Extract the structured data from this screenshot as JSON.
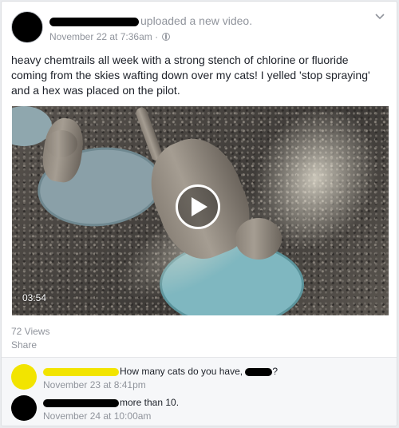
{
  "post": {
    "action_text": "uploaded a new video.",
    "timestamp": "November 22 at 7:36am",
    "meta_separator": "·",
    "text": "heavy chemtrails all week with a strong stench of chlorine or fluoride coming from the skies wafting down over my cats! I yelled 'stop spraying' and a hex was placed on the pilot.",
    "video": {
      "duration": "03:54"
    },
    "views": "72 Views",
    "share_label": "Share"
  },
  "comments": [
    {
      "text_before": "How many cats do you have, ",
      "text_after": "?",
      "time": "November 23 at 8:41pm"
    },
    {
      "text": "more than 10.",
      "time": "November 24 at 10:00am"
    }
  ],
  "colors": {
    "page_bg": "#e9ebee",
    "meta_gray": "#90949c",
    "redaction_yellow": "#f2e400",
    "redaction_black": "#000000"
  }
}
